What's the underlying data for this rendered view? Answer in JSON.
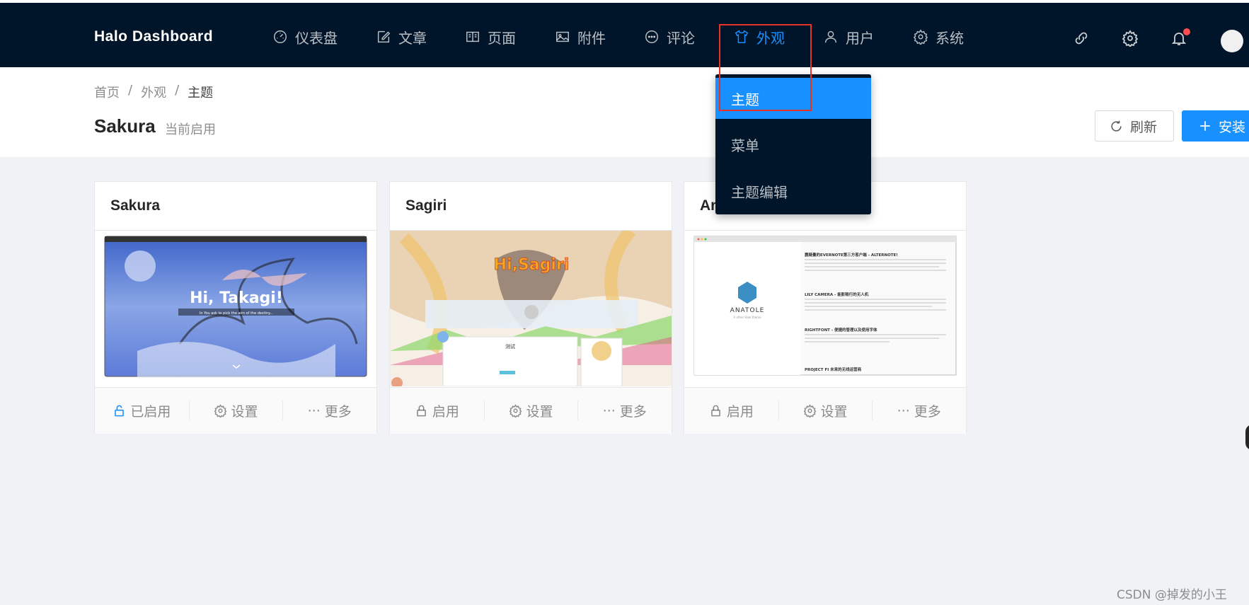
{
  "header": {
    "brand": "Halo  Dashboard",
    "nav": [
      {
        "label": "仪表盘",
        "icon": "dashboard-icon"
      },
      {
        "label": "文章",
        "icon": "edit-icon"
      },
      {
        "label": "页面",
        "icon": "book-icon"
      },
      {
        "label": "附件",
        "icon": "picture-icon"
      },
      {
        "label": "评论",
        "icon": "message-icon"
      },
      {
        "label": "外观",
        "icon": "skin-icon",
        "active": true
      },
      {
        "label": "用户",
        "icon": "user-icon"
      },
      {
        "label": "系统",
        "icon": "setting-icon"
      }
    ],
    "right_icons": [
      "link-icon",
      "gear-icon",
      "bell-icon",
      "avatar"
    ],
    "active_color": "#1890ff",
    "bg_color": "#001529"
  },
  "dropdown": {
    "items": [
      {
        "label": "主题",
        "selected": true
      },
      {
        "label": "菜单"
      },
      {
        "label": "主题编辑"
      }
    ]
  },
  "page": {
    "breadcrumb": [
      "首页",
      "外观",
      "主题"
    ],
    "title": "Sakura",
    "subtitle": "当前启用",
    "refresh_label": "刷新",
    "install_label": "安装"
  },
  "themes": [
    {
      "name": "Sakura",
      "preview_text": "Hi, Takagi!",
      "preview_tagline": "In You ask to pick the aim of the destiny...",
      "actions": {
        "enable": "已启用",
        "settings": "设置",
        "more": "更多"
      },
      "enabled": true
    },
    {
      "name": "Sagiri",
      "preview_text": "Hi,Sagiri",
      "preview_tagline": "测试",
      "actions": {
        "enable": "启用",
        "settings": "设置",
        "more": "更多"
      },
      "enabled": false
    },
    {
      "name": "Anatole",
      "preview_text": "ANATOLE",
      "preview_tagline": "A other Halo theme",
      "preview_posts": [
        "震疑量的EVERNOTE第三方客户端 - ALTERNOTE!",
        "LILY CAMERA - 能影随行的无人机",
        "RIGHTFONT - 便捷的管理以及使用字体",
        "PROJECT FI 未来的无线运营商"
      ],
      "actions": {
        "enable": "启用",
        "settings": "设置",
        "more": "更多"
      },
      "enabled": false
    }
  ],
  "watermark": "CSDN @掉发的小王"
}
